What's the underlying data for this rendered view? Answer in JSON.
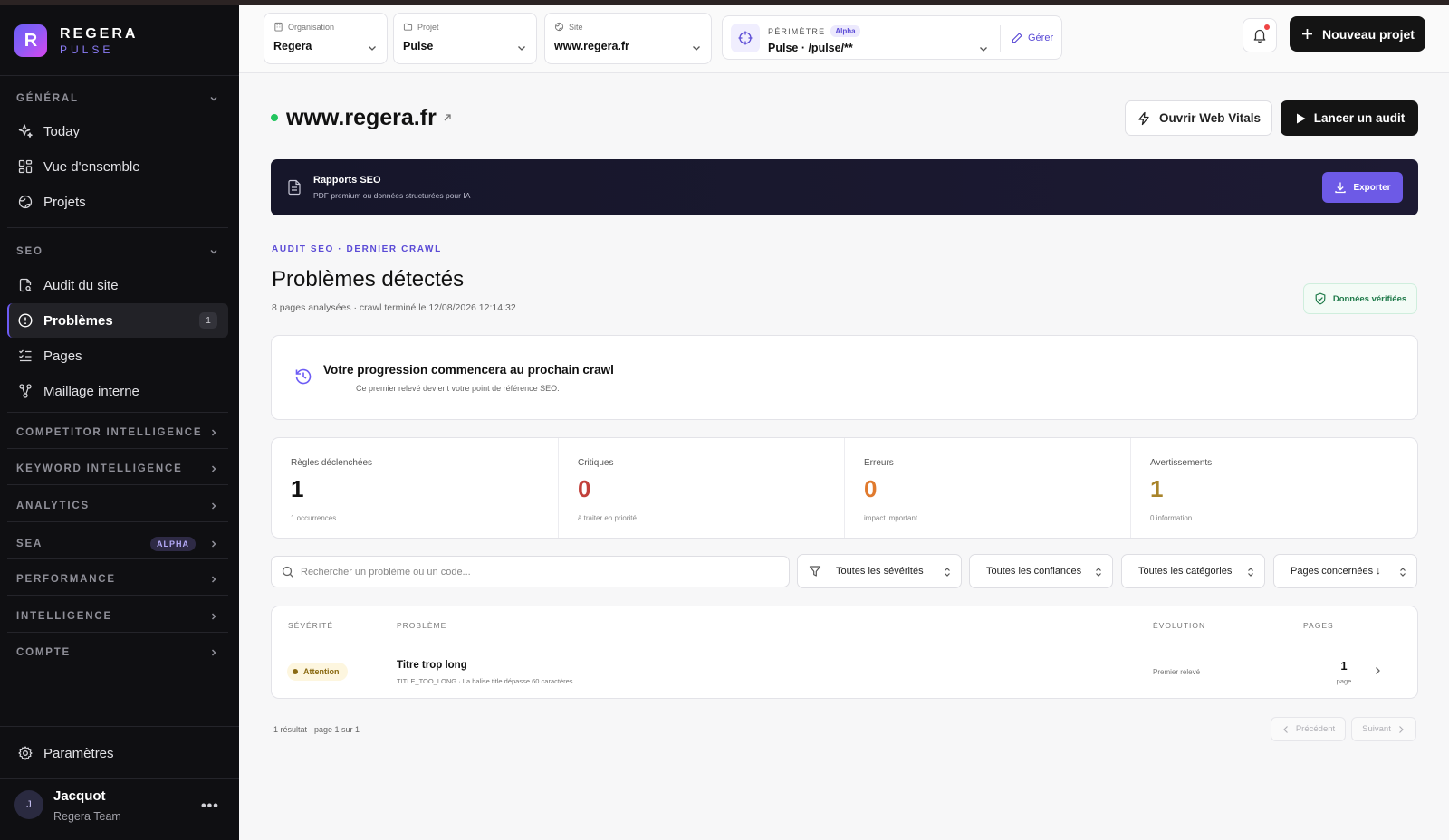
{
  "brand": {
    "logo_letter": "R",
    "name": "REGERA",
    "sub": "PULSE",
    "accent": "#6d5cf5"
  },
  "sidebar": {
    "general": {
      "title": "GÉNÉRAL",
      "items": [
        {
          "label": "Today",
          "icon": "sparkles-icon"
        },
        {
          "label": "Vue d'ensemble",
          "icon": "grid-icon"
        },
        {
          "label": "Projets",
          "icon": "globe-icon"
        }
      ]
    },
    "seo": {
      "title": "SEO",
      "items": [
        {
          "label": "Audit du site",
          "icon": "file-search-icon"
        },
        {
          "label": "Problèmes",
          "icon": "alert-circle-icon",
          "badge": "1",
          "active": true
        },
        {
          "label": "Pages",
          "icon": "list-checks-icon"
        },
        {
          "label": "Maillage interne",
          "icon": "network-icon"
        }
      ]
    },
    "sections": [
      {
        "label": "COMPETITOR INTELLIGENCE"
      },
      {
        "label": "KEYWORD INTELLIGENCE"
      },
      {
        "label": "ANALYTICS"
      },
      {
        "label": "SEA",
        "badge": "ALPHA"
      },
      {
        "label": "PERFORMANCE"
      },
      {
        "label": "INTELLIGENCE"
      },
      {
        "label": "COMPTE"
      }
    ],
    "settings": "Paramètres",
    "user": {
      "initial": "J",
      "name": "Jacquot",
      "team": "Regera Team",
      "more": "•••"
    }
  },
  "header": {
    "org": {
      "label": "Organisation",
      "value": "Regera"
    },
    "project": {
      "label": "Projet",
      "value": "Pulse"
    },
    "site": {
      "label": "Site",
      "value": "www.regera.fr"
    },
    "perimeter": {
      "label": "PÉRIMÈTRE",
      "badge": "Alpha",
      "value": "Pulse · /pulse/**",
      "edit": "Gérer"
    },
    "new_project": "Nouveau projet"
  },
  "site": {
    "title": "www.regera.fr",
    "status_color": "#22c55e",
    "web_vitals": "Ouvrir Web Vitals",
    "launch_audit": "Lancer un audit"
  },
  "seo_banner": {
    "title": "Rapports SEO",
    "subtitle": "PDF premium ou données structurées pour IA",
    "export": "Exporter"
  },
  "audit": {
    "kicker": "AUDIT SEO · DERNIER CRAWL",
    "title": "Problèmes détectés",
    "meta": "8 pages analysées · crawl terminé le 12/08/2026 12:14:32",
    "verified": "Données vérifiées"
  },
  "progress": {
    "title": "Votre progression commencera au prochain crawl",
    "subtitle": "Ce premier relevé devient votre point de référence SEO."
  },
  "stats": [
    {
      "label": "Règles déclenchées",
      "value": "1",
      "sub": "1 occurrences",
      "color": "#111111"
    },
    {
      "label": "Critiques",
      "value": "0",
      "sub": "à traiter en priorité",
      "color": "#c2403a"
    },
    {
      "label": "Erreurs",
      "value": "0",
      "sub": "impact important",
      "color": "#e07a2e"
    },
    {
      "label": "Avertissements",
      "value": "1",
      "sub": "0 information",
      "color": "#a8842a"
    }
  ],
  "filters": {
    "search_placeholder": "Rechercher un problème ou un code...",
    "severity": "Toutes les sévérités",
    "confidence": "Toutes les confiances",
    "category": "Toutes les catégories",
    "sort": "Pages concernées ↓"
  },
  "table": {
    "headers": {
      "severity": "SÉVÉRITÉ",
      "problem": "PROBLÈME",
      "evolution": "ÉVOLUTION",
      "pages": "PAGES"
    },
    "rows": [
      {
        "severity": "Attention",
        "title": "Titre trop long",
        "desc": "TITLE_TOO_LONG · La balise title dépasse 60 caractères.",
        "evolution": "Premier relevé",
        "pages": "1",
        "pages_label": "page"
      }
    ]
  },
  "pagination": {
    "result": "1 résultat · page 1 sur 1",
    "prev": "Précédent",
    "next": "Suivant"
  }
}
